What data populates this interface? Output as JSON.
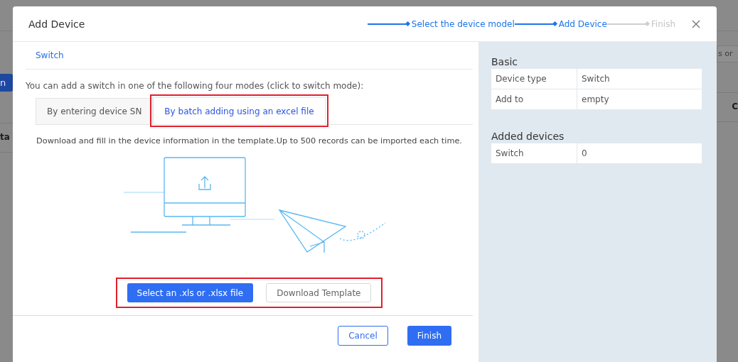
{
  "background": {
    "left": {
      "button": "n",
      "column": "ta"
    },
    "right": {
      "search": "s or",
      "column": "C"
    }
  },
  "dialog": {
    "title": "Add Device",
    "steps": [
      {
        "label": "Select the device model",
        "reached": true
      },
      {
        "label": "Add Device",
        "reached": true
      },
      {
        "label": "Finish",
        "reached": false
      }
    ],
    "section": "Switch",
    "intro": "You can add a switch in one of the following four modes (click to switch mode):",
    "modes": [
      {
        "label": "By entering device SN",
        "selected": false,
        "highlighted": false
      },
      {
        "label": "By batch adding using an excel file",
        "selected": true,
        "highlighted": true
      }
    ],
    "instructions": "Download and fill in the device information in the template.Up to 500 records can be imported each time.",
    "actions": {
      "highlighted": true,
      "select": "Select an .xls or .xlsx file",
      "download": "Download Template"
    },
    "footer": {
      "cancel": "Cancel",
      "finish": "Finish"
    },
    "summary": [
      {
        "title": "Basic",
        "rows": [
          [
            "Device type",
            "Switch"
          ],
          [
            "Add to",
            "empty"
          ]
        ]
      },
      {
        "title": "Added devices",
        "rows": [
          [
            "Switch",
            "0"
          ]
        ]
      }
    ]
  }
}
